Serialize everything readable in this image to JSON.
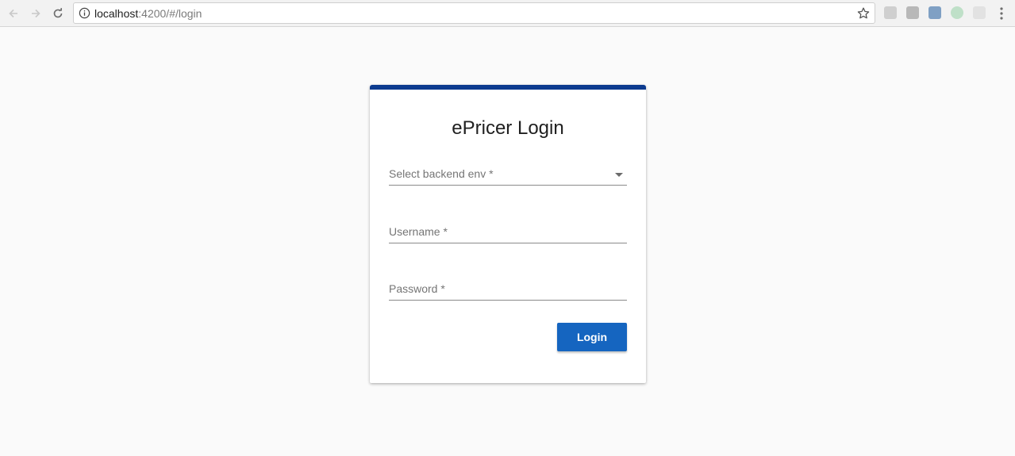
{
  "browser": {
    "url_host": "localhost",
    "url_path": ":4200/#/login"
  },
  "login": {
    "title": "ePricer Login",
    "env_label": "Select backend env *",
    "username_label": "Username *",
    "password_label": "Password *",
    "button_label": "Login"
  },
  "icons": {
    "back": "arrow-left-icon",
    "forward": "arrow-right-icon",
    "reload": "reload-icon",
    "info": "info-icon",
    "bookmark": "star-icon",
    "menu": "more-vert-icon"
  },
  "colors": {
    "accent_bar": "#0c3b8f",
    "button": "#1565c0",
    "background": "#fafafa"
  }
}
